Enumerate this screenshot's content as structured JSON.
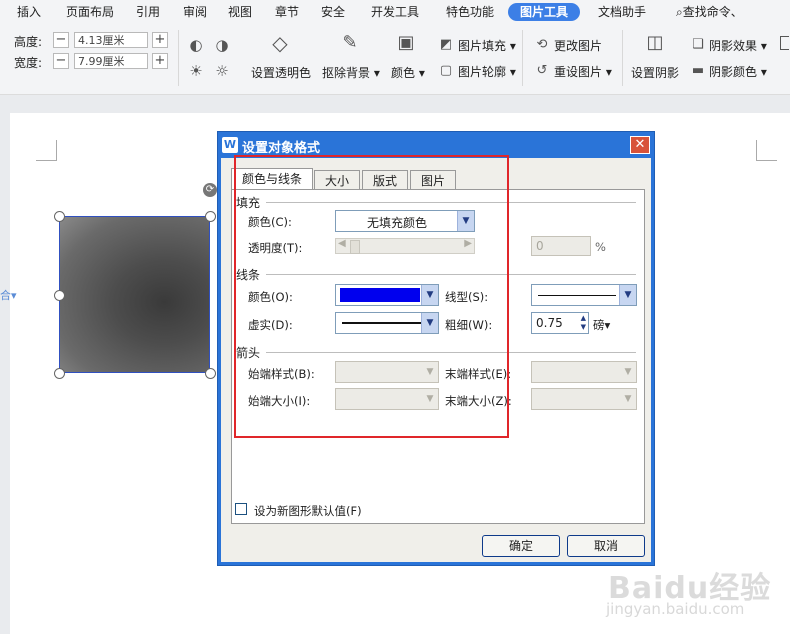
{
  "ribbon": {
    "tabs": [
      "插入",
      "页面布局",
      "引用",
      "审阅",
      "视图",
      "章节",
      "安全",
      "开发工具",
      "特色功能",
      "图片工具",
      "文档助手"
    ],
    "active_tab": "图片工具",
    "search": "查找命令、"
  },
  "toolbar": {
    "height_label": "高度:",
    "height_value": "4.13厘米",
    "width_label": "宽度:",
    "width_value": "7.99厘米",
    "set_transparent": "设置透明色",
    "remove_bg": "抠除背景",
    "color": "颜色",
    "pic_fill": "图片填充",
    "pic_outline": "图片轮廓",
    "change_pic": "更改图片",
    "reset_pic": "重设图片",
    "set_shadow": "设置阴影",
    "shadow_effect": "阴影效果",
    "shadow_color": "阴影颜色"
  },
  "dialog": {
    "title": "设置对象格式",
    "tabs": [
      "颜色与线条",
      "大小",
      "版式",
      "图片"
    ],
    "fill": {
      "section": "填充",
      "color_label": "颜色(C):",
      "color_value": "无填充颜色",
      "transparency_label": "透明度(T):",
      "transparency_value": "0",
      "percent": "%"
    },
    "line": {
      "section": "线条",
      "color_label": "颜色(O):",
      "color_swatch": "#0000ee",
      "style_label": "线型(S):",
      "dash_label": "虚实(D):",
      "weight_label": "粗细(W):",
      "weight_value": "0.75",
      "weight_unit": "磅"
    },
    "arrows": {
      "section": "箭头",
      "begin_style": "始端样式(B):",
      "end_style": "末端样式(E):",
      "begin_size": "始端大小(I):",
      "end_size": "末端大小(Z):"
    },
    "default_checkbox": "设为新图形默认值(F)",
    "ok": "确定",
    "cancel": "取消"
  },
  "watermark": {
    "brand": "Baidu经验",
    "url": "jingyan.baidu.com"
  }
}
